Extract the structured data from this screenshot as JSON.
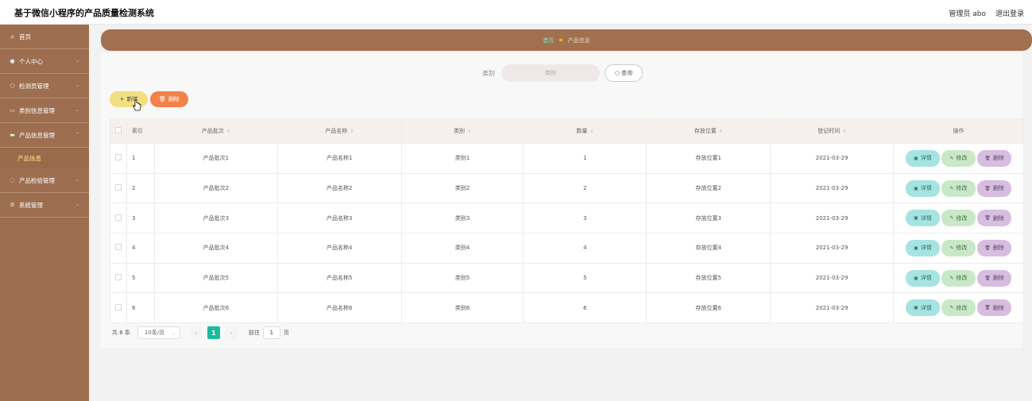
{
  "header": {
    "title": "基于微信小程序的产品质量检测系统",
    "user": "管理员 abo",
    "logout": "退出登录"
  },
  "sidebar": {
    "items": [
      {
        "label": "首页",
        "icon": "home-icon"
      },
      {
        "label": "个人中心",
        "icon": "user-icon"
      },
      {
        "label": "检测员管理",
        "icon": "people-icon"
      },
      {
        "label": "类别信息管理",
        "icon": "list-icon"
      },
      {
        "label": "产品信息管理",
        "icon": "box-icon"
      },
      {
        "label": "产品信息",
        "icon": ""
      },
      {
        "label": "产品检验管理",
        "icon": "check-icon"
      },
      {
        "label": "系统管理",
        "icon": "settings-icon"
      }
    ]
  },
  "breadcrumb": {
    "home": "首页",
    "current": "产品信息"
  },
  "search": {
    "label": "类别",
    "placeholder": "类别",
    "button": "查询"
  },
  "actions": {
    "add": "新增",
    "delete": "删除"
  },
  "table": {
    "headers": [
      "索引",
      "产品批次",
      "产品名称",
      "类别",
      "数量",
      "存放位置",
      "登记时间",
      "操作"
    ],
    "rows": [
      {
        "index": "1",
        "batch": "产品批次1",
        "name": "产品名称1",
        "category": "类别1",
        "quantity": "1",
        "location": "存放位置1",
        "date": "2021-03-29"
      },
      {
        "index": "2",
        "batch": "产品批次2",
        "name": "产品名称2",
        "category": "类别2",
        "quantity": "2",
        "location": "存放位置2",
        "date": "2021-03-29"
      },
      {
        "index": "3",
        "batch": "产品批次3",
        "name": "产品名称3",
        "category": "类别3",
        "quantity": "3",
        "location": "存放位置3",
        "date": "2021-03-29"
      },
      {
        "index": "4",
        "batch": "产品批次4",
        "name": "产品名称4",
        "category": "类别4",
        "quantity": "4",
        "location": "存放位置4",
        "date": "2021-03-29"
      },
      {
        "index": "5",
        "batch": "产品批次5",
        "name": "产品名称5",
        "category": "类别5",
        "quantity": "5",
        "location": "存放位置5",
        "date": "2021-03-29"
      },
      {
        "index": "6",
        "batch": "产品批次6",
        "name": "产品名称6",
        "category": "类别6",
        "quantity": "6",
        "location": "存放位置6",
        "date": "2021-03-29"
      }
    ],
    "ops": {
      "detail": "详情",
      "edit": "修改",
      "remove": "删除"
    }
  },
  "pagination": {
    "total": "共 6 条",
    "page_size": "10条/页",
    "current": "1",
    "goto_label": "前往",
    "goto_value": "1",
    "goto_suffix": "页"
  },
  "colors": {
    "sidebar": "#9d6e4f",
    "breadcrumb": "#a0704f",
    "accent": "#1bbc9b",
    "add": "#f2df80",
    "delete": "#f3814a"
  }
}
